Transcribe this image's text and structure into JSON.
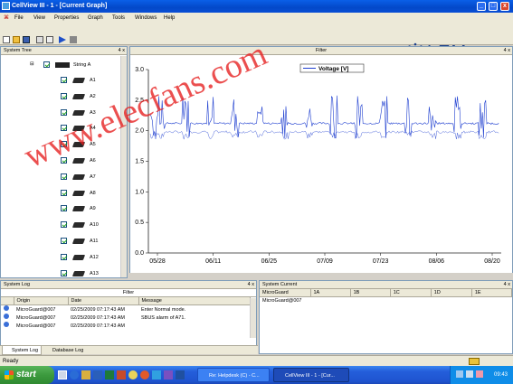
{
  "window": {
    "title": "CellView III - 1 - [Current Graph]",
    "min": "_",
    "max": "□",
    "close": "x"
  },
  "menu": [
    "File",
    "View",
    "Properties",
    "Graph",
    "Tools",
    "Windows",
    "Help"
  ],
  "brand": {
    "name": "LEM",
    "color": "#1b3f8b"
  },
  "tree": {
    "header": "System Tree",
    "pin": "4 x",
    "root": "String A",
    "items": [
      "A1",
      "A2",
      "A3",
      "A4",
      "A5",
      "A6",
      "A7",
      "A8",
      "A9",
      "A10",
      "A11",
      "A12",
      "A13"
    ]
  },
  "graph": {
    "filter": "Filter",
    "pin": "4 x"
  },
  "chart_data": {
    "type": "line",
    "title": "",
    "xlabel": "",
    "ylabel": "",
    "ylim": [
      0,
      3.0
    ],
    "yticks": [
      "0.0",
      "0.5",
      "1.0",
      "1.5",
      "2.0",
      "2.5",
      "3.0"
    ],
    "xticks": [
      "05/28",
      "06/11",
      "06/25",
      "07/09",
      "07/23",
      "08/06",
      "08/20"
    ],
    "grid": false,
    "legend": "top-center",
    "series": [
      {
        "name": "Voltage [V]",
        "color": "#1f3fd0",
        "values_note": "",
        "baseline": 2.12,
        "spikes_high": 2.55,
        "spikes_low": 1.85,
        "secondary_baseline": 1.98
      }
    ]
  },
  "log": {
    "header": "System Log",
    "pin": "4 x",
    "filter": "Filter",
    "columns": [
      "Origin",
      "Date",
      "Message"
    ],
    "rows": [
      [
        "MicroGuard@007",
        "02/25/2009 07:17:43 AM",
        "Enter Normal mode."
      ],
      [
        "MicroGuard@007",
        "02/25/2009 07:17:43 AM",
        "SBUS alarm of A71."
      ],
      [
        "MicroGuard@007",
        "02/25/2009 07:17:43 AM",
        ""
      ]
    ]
  },
  "current": {
    "header": "System Current",
    "pin": "4 x",
    "columns": [
      "MicroGuard",
      "1A",
      "1B",
      "1C",
      "1D",
      "1E"
    ],
    "rows": [
      [
        "MicroGuard@007",
        "",
        "",
        "",
        "",
        ""
      ]
    ]
  },
  "tabs": [
    "System Log",
    "Database Log"
  ],
  "status": {
    "text": "Ready"
  },
  "taskbar": {
    "start": "start",
    "tasks": [
      "Re: Helpdesk (C) - C...",
      "CellView III - 1 - [Cur..."
    ],
    "clock": "09:43"
  },
  "watermark": "www.elecfans.com"
}
